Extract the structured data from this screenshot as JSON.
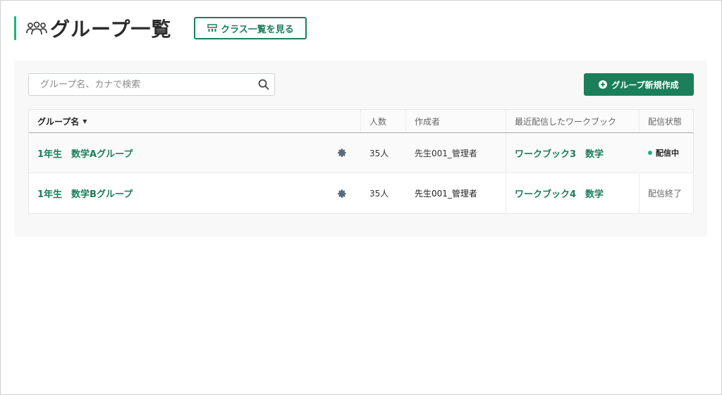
{
  "header": {
    "title": "グループ一覧",
    "class_list_button": "クラス一覧を見る"
  },
  "toolbar": {
    "search_placeholder": "グループ名、カナで検索",
    "create_button": "グループ新規作成"
  },
  "table": {
    "columns": [
      "グループ名",
      "人数",
      "作成者",
      "最近配信したワークブック",
      "配信状態"
    ],
    "rows": [
      {
        "group": "1年生　数学Aグループ",
        "count": "35人",
        "creator": "先生001_管理者",
        "workbook": "ワークブック3　数学",
        "status": "配信中",
        "status_type": "active"
      },
      {
        "group": "1年生　数学Bグループ",
        "count": "35人",
        "creator": "先生001_管理者",
        "workbook": "ワークブック4　数学",
        "status": "配信終了",
        "status_type": "ended"
      }
    ]
  },
  "colors": {
    "accent": "#1db47a",
    "brand": "#1a7f5a"
  },
  "icons": {
    "title": "people-group-icon",
    "class_button": "class-icon",
    "search": "search-icon",
    "create": "plus-circle-icon",
    "row_settings": "gear-icon",
    "sort": "caret-down-icon"
  }
}
